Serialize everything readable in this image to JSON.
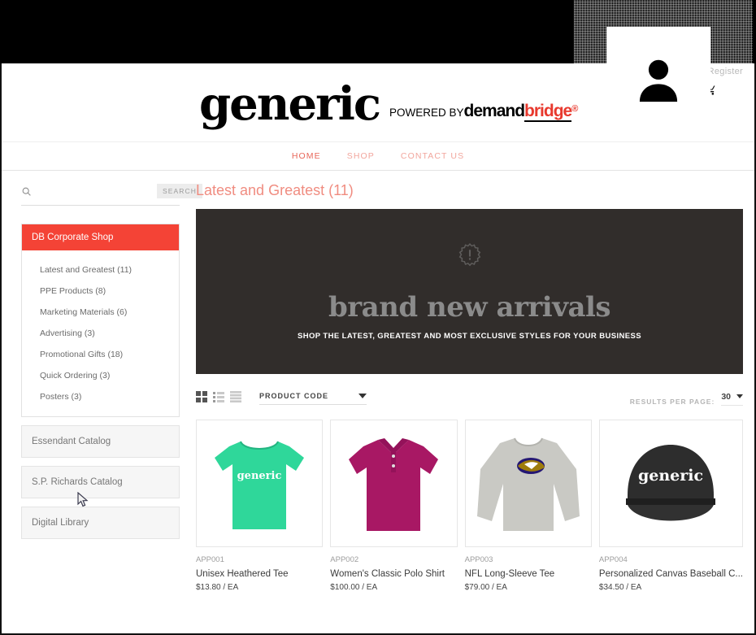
{
  "header": {
    "logo_text": "generic",
    "powered_prefix": "POWERED BY",
    "powered_brand_1": "demand",
    "powered_brand_2": "bridge",
    "powered_reg": "®",
    "account_label": "/ Register",
    "cart_icon": "shopping-cart-icon",
    "avatar_icon": "person-icon"
  },
  "nav": {
    "items": [
      {
        "label": "HOME",
        "active": true
      },
      {
        "label": "SHOP",
        "active": false
      },
      {
        "label": "CONTACT US",
        "active": false
      }
    ]
  },
  "sidebar": {
    "search": {
      "placeholder": "",
      "value": "",
      "button_label": "SEARCH",
      "icon": "search-icon"
    },
    "category_header": "DB Corporate Shop",
    "categories": [
      {
        "label": "Latest and Greatest (11)"
      },
      {
        "label": "PPE Products (8)"
      },
      {
        "label": "Marketing Materials (6)"
      },
      {
        "label": "Advertising (3)"
      },
      {
        "label": "Promotional Gifts (18)"
      },
      {
        "label": "Quick Ordering (3)"
      },
      {
        "label": "Posters (3)"
      }
    ],
    "panels": [
      {
        "label": "Essendant Catalog"
      },
      {
        "label": "S.P. Richards Catalog"
      },
      {
        "label": "Digital Library"
      }
    ]
  },
  "main": {
    "page_title": "Latest and Greatest (11)",
    "banner": {
      "badge_icon": "exclamation-badge-icon",
      "title": "brand new arrivals",
      "subtitle": "SHOP THE LATEST, GREATEST AND MOST EXCLUSIVE STYLES FOR YOUR BUSINESS"
    },
    "toolbar": {
      "view_grid_icon": "grid-view-icon",
      "view_list_icon": "list-view-icon",
      "view_compact_icon": "compact-view-icon",
      "sort_value": "PRODUCT CODE",
      "results_per_page_label": "RESULTS PER PAGE:",
      "results_per_page_value": "30"
    },
    "products": [
      {
        "code": "APP001",
        "name": "Unisex Heathered Tee",
        "price": "$13.80 / EA",
        "image": "green-tee",
        "color": "#2fd79a",
        "print": "generic"
      },
      {
        "code": "APP002",
        "name": "Women's Classic Polo Shirt",
        "price": "$100.00 / EA",
        "image": "magenta-polo",
        "color": "#a81864",
        "print": ""
      },
      {
        "code": "APP003",
        "name": "NFL Long-Sleeve Tee",
        "price": "$79.00 / EA",
        "image": "gray-longsleeve",
        "color": "#c9c9c4",
        "print": ""
      },
      {
        "code": "APP004",
        "name": "Personalized Canvas Baseball C...",
        "price": "$34.50 / EA",
        "image": "black-cap",
        "color": "#2d2d2d",
        "print": "generic"
      }
    ]
  },
  "colors": {
    "accent_red": "#f44336",
    "title_salmon": "#f08c80",
    "nav_pink": "#f2a69d",
    "banner_bg": "#312d2b"
  }
}
